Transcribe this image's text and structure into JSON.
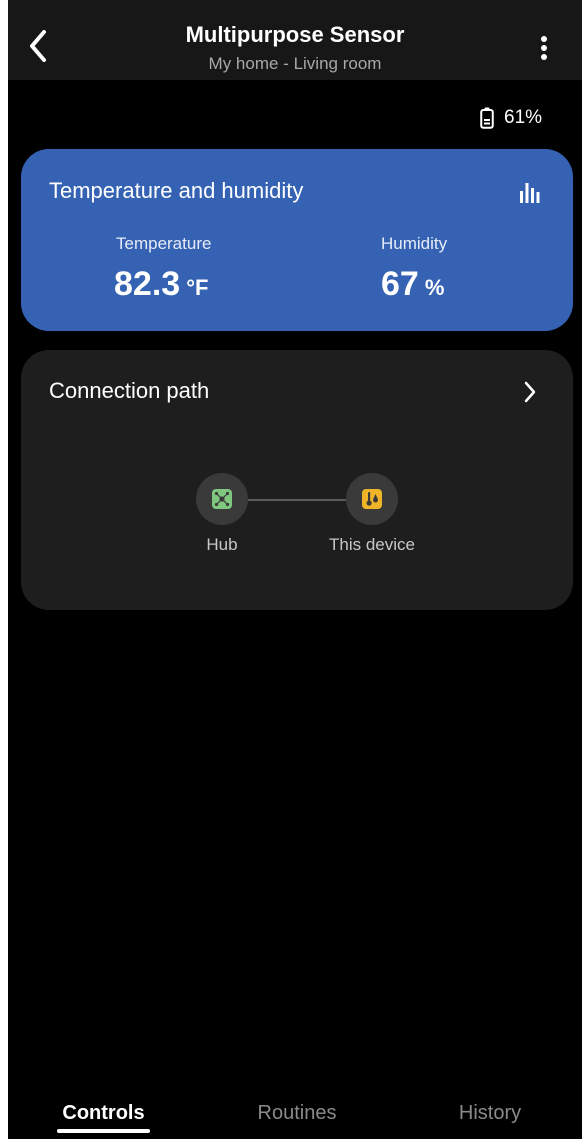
{
  "header": {
    "title": "Multipurpose Sensor",
    "subtitle": "My home - Living room",
    "back_icon": "chevron-left-icon",
    "more_icon": "more-vertical-icon"
  },
  "battery": {
    "icon": "battery-icon",
    "level": "61%"
  },
  "temp_humidity_card": {
    "title": "Temperature and humidity",
    "chart_icon": "bar-chart-icon",
    "accent_color": "#3562b3",
    "temperature": {
      "label": "Temperature",
      "value": "82.3",
      "unit": "°F"
    },
    "humidity": {
      "label": "Humidity",
      "value": "67",
      "unit": "%"
    }
  },
  "connection_card": {
    "title": "Connection path",
    "chevron_icon": "chevron-right-icon",
    "nodes": [
      {
        "label": "Hub",
        "icon": "hub-icon",
        "color": "#7fc77f"
      },
      {
        "label": "This device",
        "icon": "sensor-device-icon",
        "color": "#f0b429"
      }
    ]
  },
  "tabs": [
    {
      "label": "Controls",
      "active": true
    },
    {
      "label": "Routines",
      "active": false
    },
    {
      "label": "History",
      "active": false
    }
  ]
}
